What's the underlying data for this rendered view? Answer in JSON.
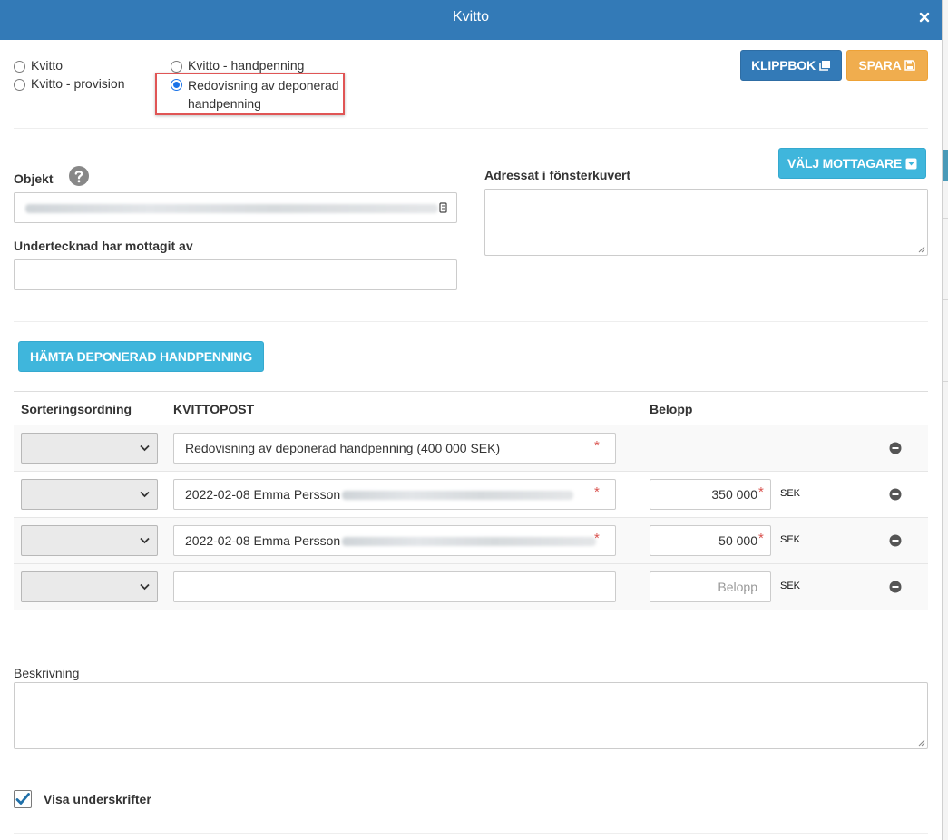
{
  "dialog": {
    "title": "Kvitto"
  },
  "receipt_type": {
    "options": [
      "Kvitto",
      "Kvitto - provision",
      "Kvitto - handpenning",
      "Redovisning av deponerad",
      "handpenning"
    ],
    "selected": "Redovisning av deponerad handpenning"
  },
  "toolbar": {
    "clipboard_label": "KLIPPBOK",
    "save_label": "SPARA"
  },
  "recipient": {
    "choose_label": "VÄLJ MOTTAGARE",
    "address_label": "Adressat i fönsterkuvert"
  },
  "object": {
    "label": "Objekt",
    "received_by_label": "Undertecknad har mottagit av"
  },
  "fetch_button": "HÄMTA DEPONERAD HANDPENNING",
  "table": {
    "headers": [
      "Sorteringsordning",
      "KVITTOPOST",
      "Belopp"
    ],
    "rows": [
      {
        "post": "Redovisning av deponerad handpenning (400 000 SEK)",
        "amount": "",
        "currency": ""
      },
      {
        "post": "2022-02-08 Emma Persson",
        "amount": "350 000",
        "currency": "SEK"
      },
      {
        "post": "2022-02-08 Emma Persson",
        "amount": "50 000",
        "currency": "SEK"
      },
      {
        "post": "",
        "amount": "",
        "currency": "SEK"
      }
    ],
    "amount_placeholder": "Belopp",
    "required_mark": "*"
  },
  "description": {
    "label": "Beskrivning"
  },
  "signatures": {
    "label": "Visa underskrifter",
    "checked": true
  },
  "colors": {
    "primary": "#337ab7",
    "warning": "#f0ad4e",
    "info": "#3fb6dc",
    "highlight": "#e05555"
  }
}
